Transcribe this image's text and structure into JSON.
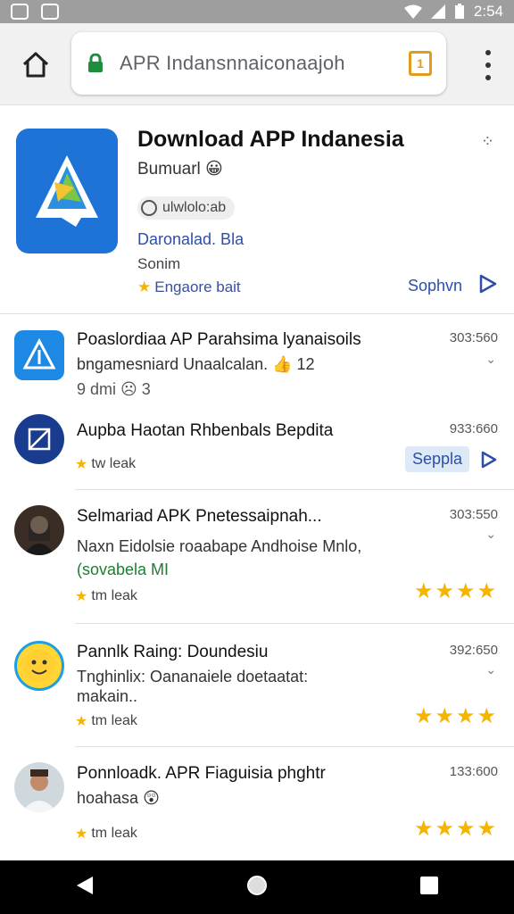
{
  "status_bar": {
    "time": "2:54"
  },
  "browser": {
    "url": "APR Indansnnaiconaajoh",
    "tab_count": "1"
  },
  "hero": {
    "title": "Download APP Indanesia",
    "subtitle": "Bumuarl 😀",
    "chip_label": "ulwlolo:ab",
    "link": "Daronalad. Bla",
    "meta": "Sonim",
    "rating_label": "Engaore bait",
    "action_label": "Sophvn"
  },
  "items": [
    {
      "title": "Poaslordiaa AP Parahsima lyanaisoils",
      "line2": "bngamesniard Unaalcalan. 👍 12",
      "line3": "9 dmi ☹ 3",
      "size": "303:560",
      "rating": "",
      "stars": ""
    },
    {
      "title": "Aupba Haotan Rhbenbals Bepdita",
      "line2": "",
      "line3": "",
      "size": "933:660",
      "rating": "tw leak",
      "stars": "",
      "button_label": "Seppla"
    },
    {
      "title": "Selmariad APK Pnetessaipnah...",
      "line2": "Naxn Eidolsie roaabape Andhoise Mnlo,",
      "line3": "(sovabela MI",
      "size": "303:550",
      "rating": "tm leak",
      "stars": "★★★★"
    },
    {
      "title": "Pannlk Raing: Doundesiu",
      "line2": "Tnghinlix: Oananaiele doetaatat:",
      "line3": "makain..",
      "size": "392:650",
      "rating": "tm leak",
      "stars": "★★★★"
    },
    {
      "title": "Ponnloadk. APR Fiaguisia phghtr",
      "line2": "hoahasa 😲",
      "line3": "",
      "size": "133:600",
      "rating": "tm leak",
      "stars": "★★★★"
    }
  ],
  "colors": {
    "accent": "#2d4fa8",
    "star": "#f4b400",
    "app_icon_blue": "#1e74d6",
    "status_bar": "#9e9e9e"
  }
}
